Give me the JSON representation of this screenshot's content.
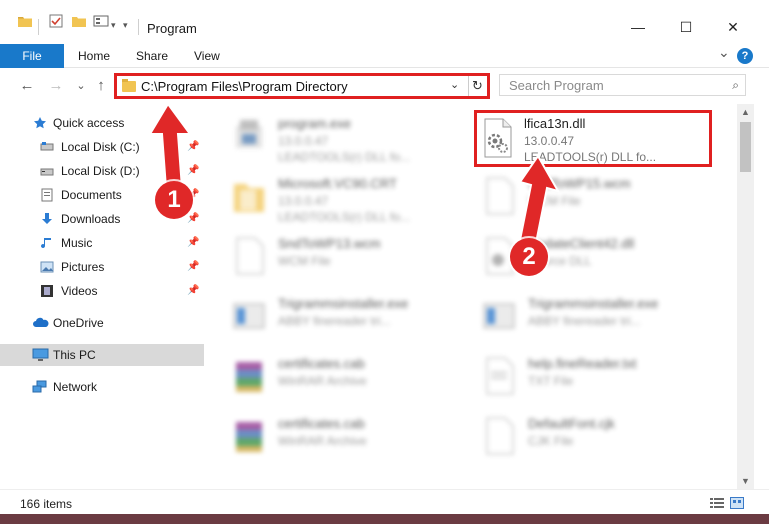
{
  "window": {
    "title": "Program",
    "minimize": "—",
    "maximize": "☐",
    "close": "✕"
  },
  "ribbon": {
    "tabs": [
      "File",
      "Home",
      "Share",
      "View"
    ],
    "expand": "⌄",
    "help": "?"
  },
  "nav": {
    "back": "←",
    "forward": "→",
    "recent": "⌄",
    "up": "↑",
    "address": "C:\\Program Files\\Program Directory",
    "address_dropdown": "⌄",
    "refresh": "↻",
    "search_placeholder": "Search Program",
    "search_icon": "⌕"
  },
  "sidebar": {
    "items": [
      {
        "label": "Quick access",
        "icon": "star-icon",
        "pinned": false
      },
      {
        "label": "Local Disk (C:)",
        "icon": "drive-icon",
        "pinned": true
      },
      {
        "label": "Local Disk (D:)",
        "icon": "drive-icon",
        "pinned": true
      },
      {
        "label": "Documents",
        "icon": "documents-icon",
        "pinned": true
      },
      {
        "label": "Downloads",
        "icon": "download-icon",
        "pinned": true
      },
      {
        "label": "Music",
        "icon": "music-icon",
        "pinned": true
      },
      {
        "label": "Pictures",
        "icon": "pictures-icon",
        "pinned": true
      },
      {
        "label": "Videos",
        "icon": "videos-icon",
        "pinned": true
      },
      {
        "label": "OneDrive",
        "icon": "cloud-icon",
        "pinned": false
      },
      {
        "label": "This PC",
        "icon": "computer-icon",
        "pinned": false,
        "selected": true
      },
      {
        "label": "Network",
        "icon": "network-icon",
        "pinned": false
      }
    ],
    "pin_glyph": "📌"
  },
  "files": [
    {
      "name": "program.exe",
      "l2": "13.0.0.47",
      "l3": "LEADTOOLS(r) DLL fo..."
    },
    {
      "name": "Microsoft.VC90.CRT",
      "l2": "13.0.0.47",
      "l3": "LEADTOOLS(r) DLL fo..."
    },
    {
      "name": "SndToWP15.wcm",
      "l2": "WCM File",
      "l3": ""
    },
    {
      "name": "SndToWP13.wcm",
      "l2": "WCM File",
      "l3": ""
    },
    {
      "name": "UpdateClient42.dll",
      "l2": "Source DLL",
      "l3": ""
    },
    {
      "name": "Trigrammsinstaller.exe",
      "l2": "ABBY finereader tri...",
      "l3": ""
    },
    {
      "name": "Trigrammsinstaller.exe",
      "l2": "ABBY finereader tri...",
      "l3": ""
    },
    {
      "name": "certificates.cab",
      "l2": "WinRAR Archive",
      "l3": ""
    },
    {
      "name": "help.fineReader.txt",
      "l2": "TXT File",
      "l3": ""
    },
    {
      "name": "certificates.cab",
      "l2": "WinRAR Archive",
      "l3": ""
    },
    {
      "name": "DefaultFont.cjk",
      "l2": "CJK File",
      "l3": ""
    }
  ],
  "highlighted_file": {
    "name": "lfica13n.dll",
    "l2": "13.0.0.47",
    "l3": "LEADTOOLS(r) DLL fo..."
  },
  "status": {
    "count": "166 items"
  },
  "callouts": [
    "1",
    "2"
  ],
  "colors": {
    "accent": "#1979ca",
    "highlight_red": "#e02020",
    "selected_bg": "#d9d9d9"
  }
}
